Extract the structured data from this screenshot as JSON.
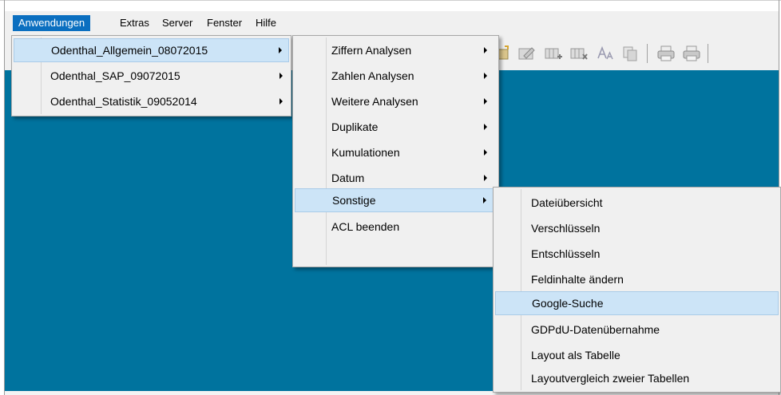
{
  "menubar": {
    "items": [
      "Anwendungen",
      "Extras",
      "Server",
      "Fenster",
      "Hilfe"
    ],
    "active": "Anwendungen"
  },
  "toolbar": {
    "icons": [
      "folder-open-icon",
      "edit-icon",
      "add-field-icon",
      "delete-field-icon",
      "font-size-icon",
      "copy-icon",
      "print-preview-icon",
      "print-icon"
    ]
  },
  "menu_level1": {
    "items": [
      "Odenthal_Allgemein_08072015",
      "Odenthal_SAP_09072015",
      "Odenthal_Statistik_09052014"
    ],
    "highlighted": "Odenthal_Allgemein_08072015"
  },
  "menu_level2": {
    "items": [
      "Ziffern Analysen",
      "Zahlen Analysen",
      "Weitere Analysen",
      "Duplikate",
      "Kumulationen",
      "Datum",
      "Sonstige",
      "ACL beenden"
    ],
    "highlighted": "Sonstige"
  },
  "menu_level3": {
    "items": [
      "Dateiübersicht",
      "Verschlüsseln",
      "Entschlüsseln",
      "Feldinhalte ändern",
      "Google-Suche",
      "GDPdU-Datenübernahme",
      "Layout als Tabelle",
      "Layoutvergleich zweier Tabellen"
    ],
    "highlighted": "Google-Suche"
  },
  "colors": {
    "workspace": "#00739e",
    "menubar_active": "#0b6fc0",
    "menu_highlight": "#cce4f7",
    "menu_bg": "#f0f0f0"
  }
}
